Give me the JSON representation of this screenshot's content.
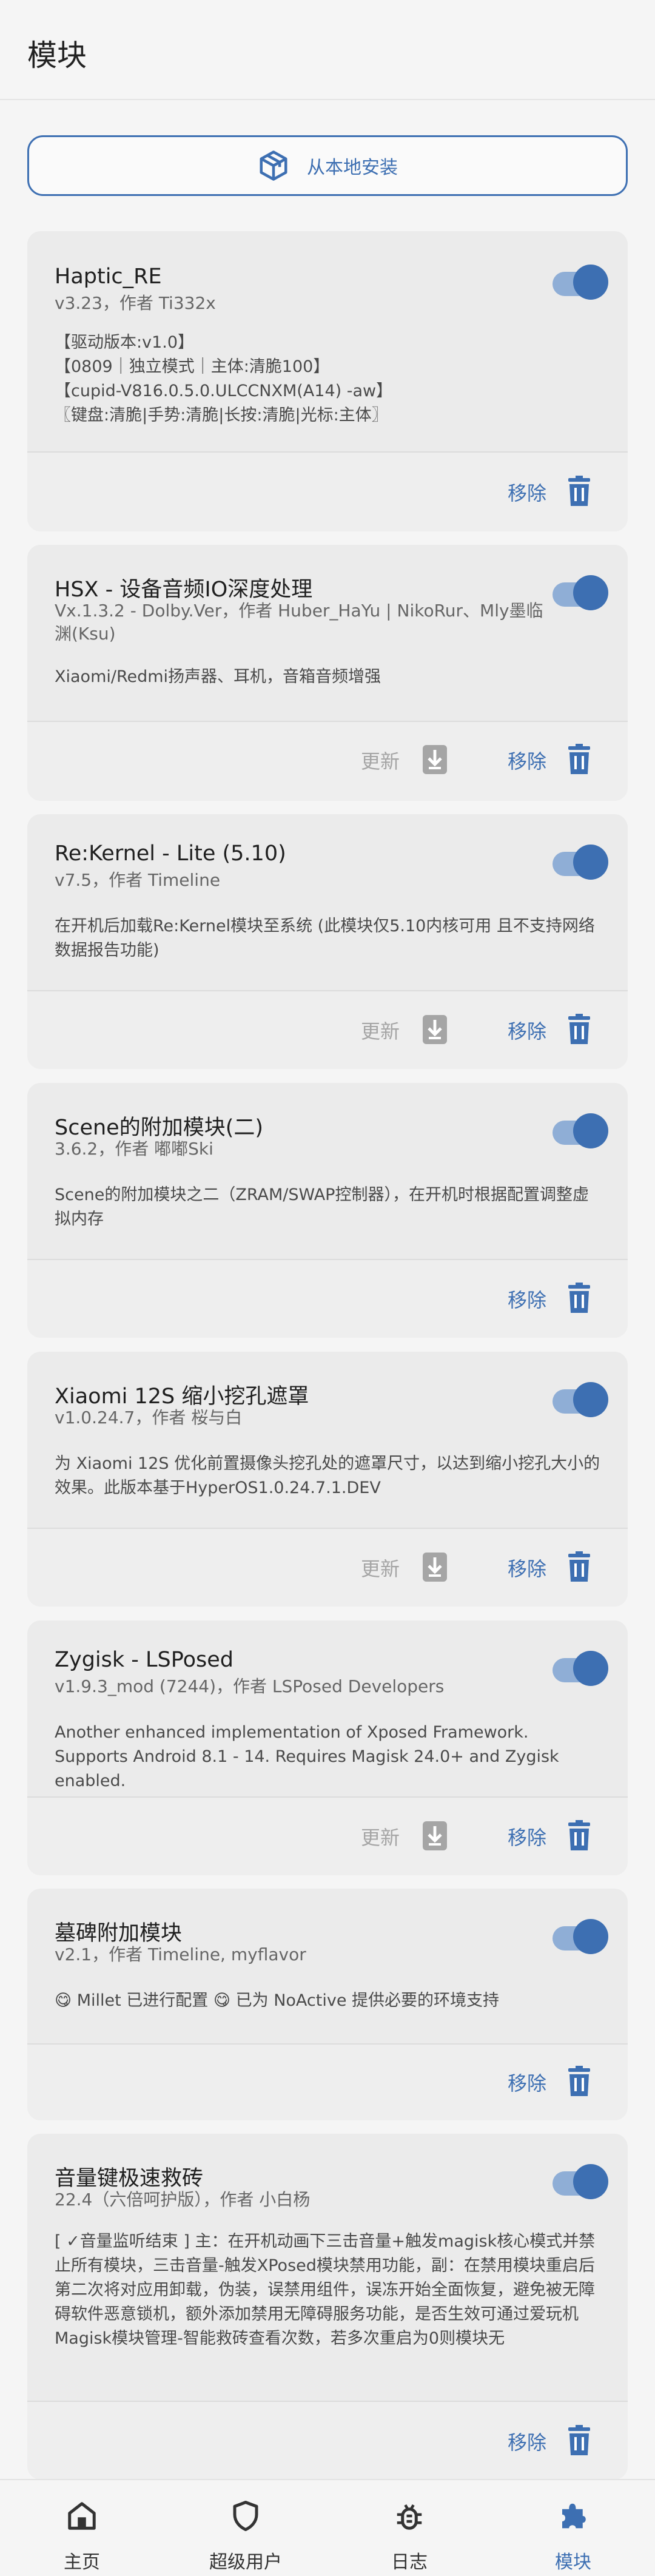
{
  "appbar": {
    "title": "模块"
  },
  "install": {
    "label": "从本地安装"
  },
  "colors": {
    "accent": "#3d6fb2",
    "card_bg": "#ebebeb",
    "disabled": "#a5a5a5"
  },
  "actions": {
    "remove": "移除",
    "update": "更新"
  },
  "modules": [
    {
      "name": "Haptic_RE",
      "meta": "v3.23，作者 Ti332x",
      "desc": "【驱动版本:v1.0】\n【0809｜独立模式｜主体:清脆100】\n【cupid-V816.0.5.0.ULCCNXM(A14) -aw】\n〖键盘:清脆|手势:清脆|长按:清脆|光标:主体〗",
      "enabled": true,
      "has_update": false
    },
    {
      "name": "HSX - 设备音频IO深度处理",
      "meta": "Vx.1.3.2 - Dolby.Ver，作者 Huber_HaYu | NikoRur、Mly墨临渊(Ksu)",
      "desc": "Xiaomi/Redmi扬声器、耳机，音箱音频增强",
      "enabled": true,
      "has_update": true
    },
    {
      "name": "Re:Kernel - Lite (5.10)",
      "meta": "v7.5，作者 Timeline",
      "desc": "在开机后加载Re:Kernel模块至系统 (此模块仅5.10内核可用 且不支持网络数据报告功能)",
      "enabled": true,
      "has_update": true
    },
    {
      "name": "Scene的附加模块(二)",
      "meta": "3.6.2，作者 嘟嘟Ski",
      "desc": "Scene的附加模块之二（ZRAM/SWAP控制器），在开机时根据配置调整虚拟内存",
      "enabled": true,
      "has_update": false
    },
    {
      "name": "Xiaomi 12S 缩小挖孔遮罩",
      "meta": "v1.0.24.7，作者 桜与白",
      "desc": "为 Xiaomi 12S 优化前置摄像头挖孔处的遮罩尺寸，以达到缩小挖孔大小的效果。此版本基于HyperOS1.0.24.7.1.DEV",
      "enabled": true,
      "has_update": true
    },
    {
      "name": "Zygisk - LSPosed",
      "meta": "v1.9.3_mod (7244)，作者 LSPosed Developers",
      "desc": "Another enhanced implementation of Xposed Framework. Supports Android 8.1 - 14. Requires Magisk 24.0+ and Zygisk enabled.",
      "enabled": true,
      "has_update": true
    },
    {
      "name": "墓碑附加模块",
      "meta": "v2.1，作者 Timeline, myflavor",
      "desc": "😋 Millet 已进行配置 😋 已为 NoActive 提供必要的环境支持",
      "enabled": true,
      "has_update": false
    },
    {
      "name": "音量键极速救砖",
      "meta": "22.4（六倍呵护版），作者 小白杨",
      "desc": "[ ✓音量监听结束 ] 主：在开机动画下三击音量+触发magisk核心模式并禁止所有模块，三击音量-触发XPosed模块禁用功能，副：在禁用模块重启后第二次将对应用卸载，伪装，误禁用组件，误冻开始全面恢复，避免被无障碍软件恶意锁机，额外添加禁用无障碍服务功能，是否生效可通过爱玩机Magisk模块管理-智能救砖查看次数，若多次重启为0则模块无",
      "enabled": true,
      "has_update": false
    }
  ],
  "nav": [
    {
      "label": "主页",
      "icon": "home-icon"
    },
    {
      "label": "超级用户",
      "icon": "shield-icon"
    },
    {
      "label": "日志",
      "icon": "bug-icon"
    },
    {
      "label": "模块",
      "icon": "puzzle-icon",
      "active": true
    }
  ]
}
